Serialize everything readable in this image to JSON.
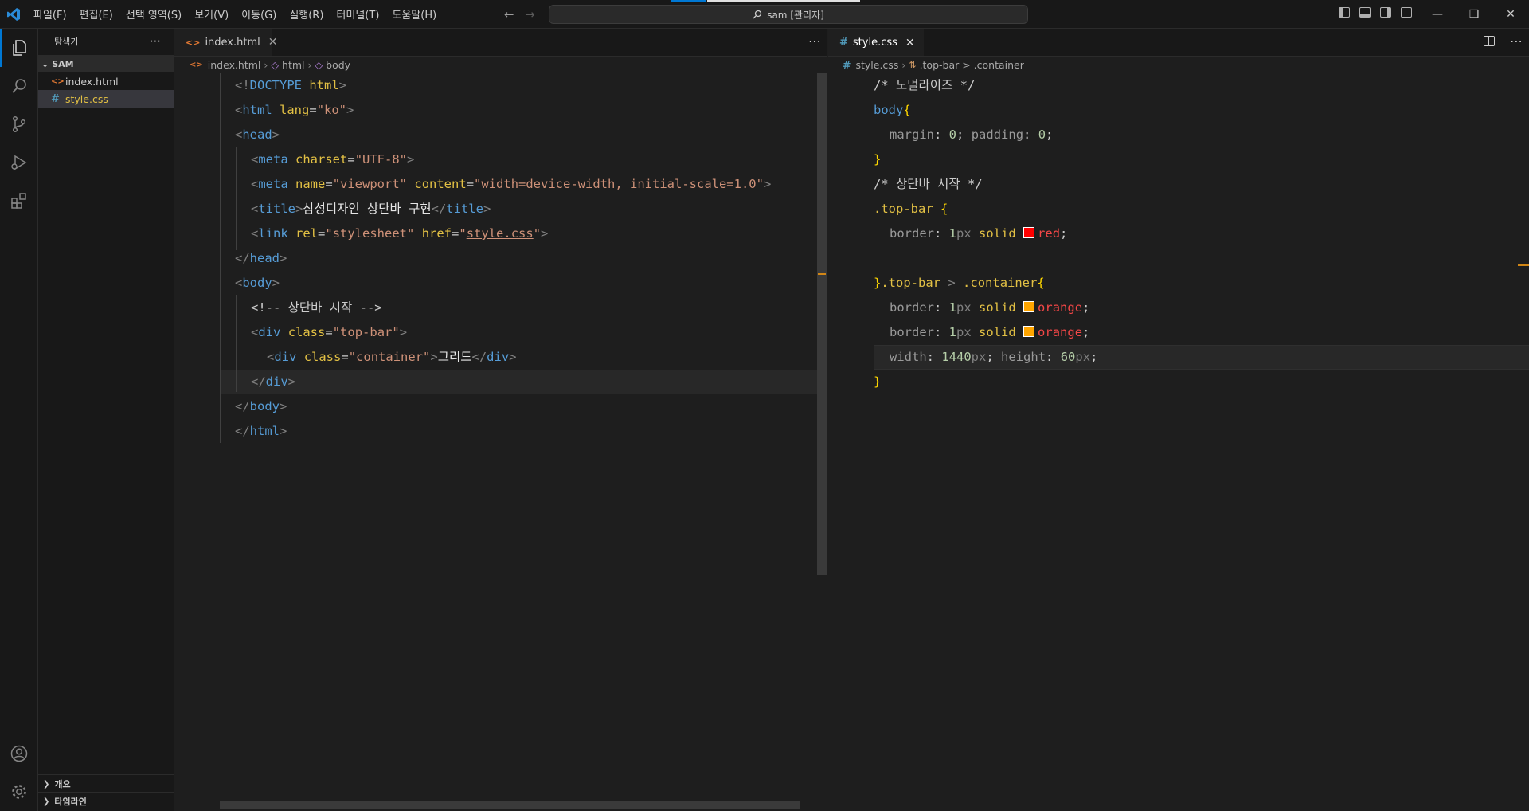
{
  "menu": [
    "파일(F)",
    "편집(E)",
    "선택 영역(S)",
    "보기(V)",
    "이동(G)",
    "실행(R)",
    "터미널(T)",
    "도움말(H)"
  ],
  "command_center": "sam [관리자]",
  "sidebar": {
    "title": "탐색기",
    "folder": "SAM",
    "files": [
      {
        "name": "index.html",
        "icon": "html-icon"
      },
      {
        "name": "style.css",
        "icon": "css-icon"
      }
    ],
    "sections": [
      "개요",
      "타임라인"
    ]
  },
  "left_editor": {
    "tab": "index.html",
    "breadcrumb": [
      "index.html",
      "html",
      "body"
    ]
  },
  "right_editor": {
    "tab": "style.css",
    "breadcrumb": [
      "style.css",
      ".top-bar > .container"
    ]
  },
  "html_lines": [
    "<!DOCTYPE html>",
    "<html lang=\"ko\">",
    "<head>",
    "<meta charset=\"UTF-8\">",
    "<meta name=\"viewport\" content=\"width=device-width, initial-scale=1.0\">",
    "<title>삼성디자인 상단바 구현</title>",
    "<link rel=\"stylesheet\" href=\"style.css\">",
    "</head>",
    "<body>",
    "<!-- 상단바 시작 -->",
    "<div class=\"top-bar\">",
    "<div class=\"container\">그리드</div>",
    "</div>",
    "</body>",
    "</html>"
  ],
  "css_lines": [
    "/* 노멀라이즈 */",
    "body{",
    "margin: 0; padding: 0;",
    "}",
    "/* 상단바 시작 */",
    ".top-bar {",
    "border: 1px solid red;",
    "",
    "}.top-bar > .container{",
    "border: 1px solid orange;",
    "border: 1px solid orange;",
    "width: 1440px; height: 60px;",
    "}"
  ],
  "colors": {
    "accent": "#0078d4",
    "red": "#ff0000",
    "orange": "#ffa500"
  }
}
